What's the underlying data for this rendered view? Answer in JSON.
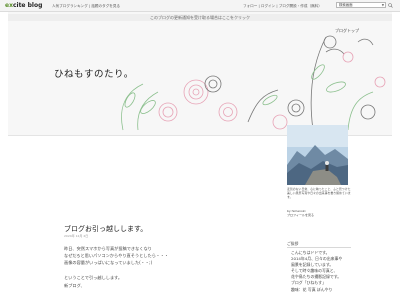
{
  "topbar": {
    "logo_ex": "ex",
    "logo_rest": "cite blog",
    "links": "人気ブログランキング | 話題のタグを見る",
    "right_links": "フォロー | ログイン | ブログ開設・作成（無料）",
    "search_value": "検索画面"
  },
  "header": {
    "notice": "このブログの更新通知を受け取る場合はここをクリック",
    "title": "ひねもすのたり。",
    "top_link": "ブログトップ"
  },
  "post": {
    "title": "ブログお引っ越しします。",
    "date": "2024年 12月 2日",
    "lines": [
      "昨日、突然スマホから写真が投稿できなくなり",
      "なぜだろと思いパソコンからやり直そうとしたら・・・",
      "画像の容量がいっぱいになっていました(・・;)",
      "",
      "ということで引っ越しします。",
      "新ブログ、"
    ]
  },
  "sidebar": {
    "profile_text": "変哲のない日常、心に映ったこと、ふと見つけた美しい風景写真や日々の出来事を書き留めています。",
    "profile_user": "by himenoki",
    "profile_link": "プロフィールを見る",
    "heading": "ご挨拶",
    "greeting_lines": [
      "こんにちはドドです。",
      "2014年4月、日々の出来事や",
      "風景を記録しています。",
      "そして時々趣味の写真と、",
      "花や鳥たちの撮影記録です。",
      "ブログ「ひねもす」",
      "趣味：花 写真 ぼんやり"
    ]
  },
  "colors": {
    "accent": "#5a8f2a",
    "flower_pink": "#e7a3b6",
    "leaf_green": "#8cc08e"
  }
}
